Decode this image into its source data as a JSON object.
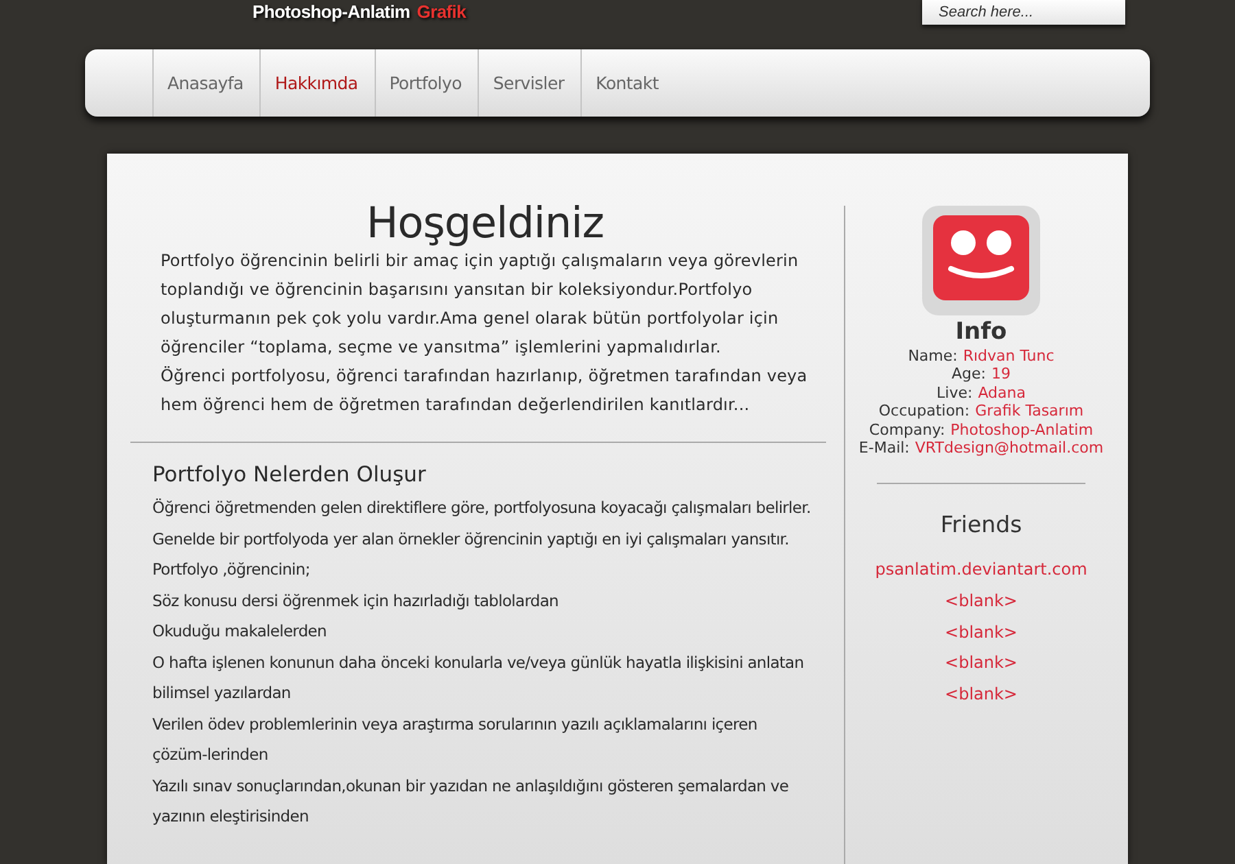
{
  "header": {
    "tagline": "Photoshop-Anlatim",
    "tagline_accent": "Grafik"
  },
  "search": {
    "placeholder": "Search here..."
  },
  "nav": [
    {
      "label": "Anasayfa",
      "selected": false
    },
    {
      "label": "Hakkımda",
      "selected": true
    },
    {
      "label": "Portfolyo",
      "selected": false
    },
    {
      "label": "Servisler",
      "selected": false
    },
    {
      "label": "Kontakt",
      "selected": false
    }
  ],
  "main": {
    "title": "Hoşgeldiniz",
    "intro": [
      "Portfolyo öğrencinin belirli bir amaç için yaptığı çalışmaların veya görevlerin toplandığı ve öğrencinin başarısını yansıtan bir koleksiyondur.Portfolyo oluşturmanın pek çok yolu vardır.Ama genel olarak bütün portfolyolar için öğrenciler “toplama, seçme ve yansıtma” işlemlerini yapmalıdırlar.",
      "Öğrenci portfolyosu, öğrenci tarafından hazırlanıp, öğretmen tarafından veya hem öğrenci hem de öğretmen tarafından değerlendirilen kanıtlardır..."
    ],
    "section_title": "Portfolyo Nelerden Oluşur",
    "section_lines": [
      "Öğrenci öğretmenden gelen direktiflere göre, portfolyosuna koyacağı çalışmaları belirler.",
      "Genelde bir portfolyoda yer alan örnekler öğrencinin yaptığı en iyi çalışmaları yansıtır.",
      "Portfolyo ,öğrencinin;",
      "Söz konusu dersi öğrenmek için hazırladığı tablolardan",
      "Okuduğu makalelerden",
      "O hafta işlenen konunun daha önceki konularla ve/veya günlük hayatla ilişkisini anlatan bilimsel yazılardan",
      "Verilen ödev problemlerinin veya araştırma sorularının yazılı açıklamalarını içeren çözüm-lerinden",
      "Yazılı sınav sonuçlarından,okunan bir yazıdan ne anlaşıldığını gösteren şemalardan ve yazının eleştirisinden"
    ]
  },
  "sidebar": {
    "info_title": "Info",
    "info": [
      {
        "label": "Name:",
        "value": "Rıdvan Tunc"
      },
      {
        "label": "Age:",
        "value": "19"
      },
      {
        "label": "Live:",
        "value": "Adana"
      },
      {
        "label": "Occupation:",
        "value": "Grafik Tasarım"
      },
      {
        "label": "Company:",
        "value": "Photoshop-Anlatim"
      },
      {
        "label": "E-Mail:",
        "value": "VRTdesign@hotmail.com"
      }
    ],
    "friends_title": "Friends",
    "friends": [
      "psanlatim.deviantart.com",
      "<blank>",
      "<blank>",
      "<blank>",
      "<blank>"
    ]
  }
}
